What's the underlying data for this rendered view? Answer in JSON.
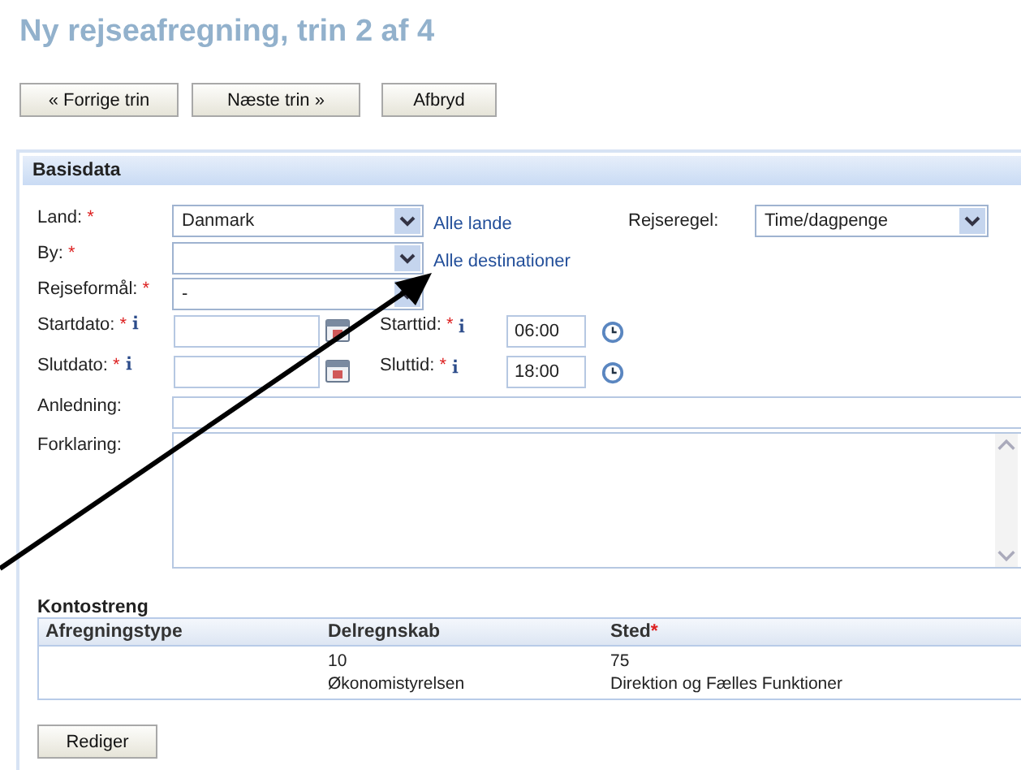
{
  "title": "Ny rejseafregning, trin 2 af 4",
  "buttons": [
    "« Forrige trin",
    "Næste trin »",
    "Afbryd"
  ],
  "basisdata": {
    "title": "Basisdata",
    "land": {
      "label": "Land:",
      "mark": "*",
      "value": "Danmark",
      "link": "Alle lande"
    },
    "rejseregel": {
      "label": "Rejseregel:",
      "value": "Time/dagpenge"
    },
    "by": {
      "label": "By:",
      "mark": "*",
      "link": "Alle destinationer"
    },
    "rejseformaal": {
      "label": "Rejseformål:",
      "mark": "*",
      "value": "-"
    },
    "startdato": {
      "label": "Startdato:",
      "mark": "*",
      "info": true
    },
    "starttid": {
      "label": "Starttid:",
      "mark": "*",
      "info": true,
      "value": "06:00"
    },
    "slutdato": {
      "label": "Slutdato:",
      "mark": "*",
      "info": true
    },
    "sluttid": {
      "label": "Sluttid:",
      "mark": "*",
      "info": true,
      "value": "18:00"
    },
    "anledning": {
      "label": "Anledning:"
    },
    "forklaring": {
      "label": "Forklaring:"
    }
  },
  "kontostreng": {
    "title": "Kontostreng",
    "columns": [
      {
        "label": "Afregningstype"
      },
      {
        "label": "Delregnskab"
      },
      {
        "label": "Sted",
        "mark": "*"
      }
    ],
    "rows": [
      {
        "delregnskab": [
          "10",
          "Økonomistyrelsen"
        ],
        "sted": [
          "75",
          "Direktion og Fælles Funktioner"
        ]
      }
    ]
  },
  "edit_button": "Rediger"
}
